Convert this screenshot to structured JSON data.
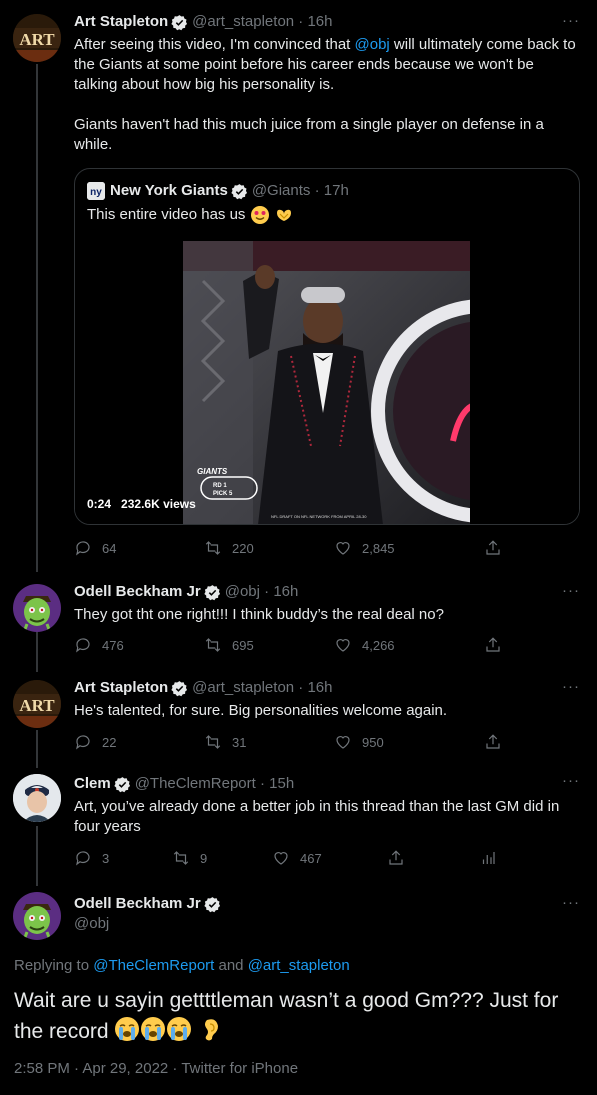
{
  "tweets": [
    {
      "name": "Art Stapleton",
      "handle": "@art_stapleton",
      "time": "16h",
      "text_pre": "After seeing this video, I'm convinced that ",
      "mention": "@obj",
      "text_post": " will ultimately come back to the Giants at some point before his career ends because we won't be talking about how big his personality is.",
      "text2": "Giants haven't had this much juice from a single player on defense in a while.",
      "replies": "64",
      "retweets": "220",
      "likes": "2,845"
    },
    {
      "name": "Odell Beckham Jr",
      "handle": "@obj",
      "time": "16h",
      "text": "They got tht one right!!! I think buddy’s the real deal no?",
      "replies": "476",
      "retweets": "695",
      "likes": "4,266"
    },
    {
      "name": "Art Stapleton",
      "handle": "@art_stapleton",
      "time": "16h",
      "text": "He's talented, for sure. Big personalities welcome again.",
      "replies": "22",
      "retweets": "31",
      "likes": "950"
    },
    {
      "name": "Clem",
      "handle": "@TheClemReport",
      "time": "15h",
      "text": "Art, you’ve already done a better job in this thread than the last GM did in four years",
      "replies": "3",
      "retweets": "9",
      "likes": "467"
    }
  ],
  "quote": {
    "name": "New York Giants",
    "handle": "@Giants",
    "time": "17h",
    "text": "This entire video has us",
    "video_time": "0:24",
    "video_views": "232.6K views",
    "overlay_brand": "GIANTS",
    "overlay_round": "RD 1",
    "overlay_pick": "PICK 5",
    "overlay_caption": "NFL DRAFT ON NFL NETWORK FROM APRIL 28-30"
  },
  "main": {
    "name": "Odell Beckham Jr",
    "handle": "@obj",
    "replying_label": "Replying to ",
    "replying_to_1": "@TheClemReport",
    "replying_and": " and ",
    "replying_to_2": "@art_stapleton",
    "text": "Wait are u sayin gettttleman wasn’t a good Gm??? Just for the record",
    "timestamp": "2:58 PM · Apr 29, 2022 · Twitter for iPhone"
  },
  "colors": {
    "background": "#000000",
    "text": "#e7e9ea",
    "muted": "#71767b",
    "link": "#1d9bf0",
    "border": "#2f3336"
  }
}
